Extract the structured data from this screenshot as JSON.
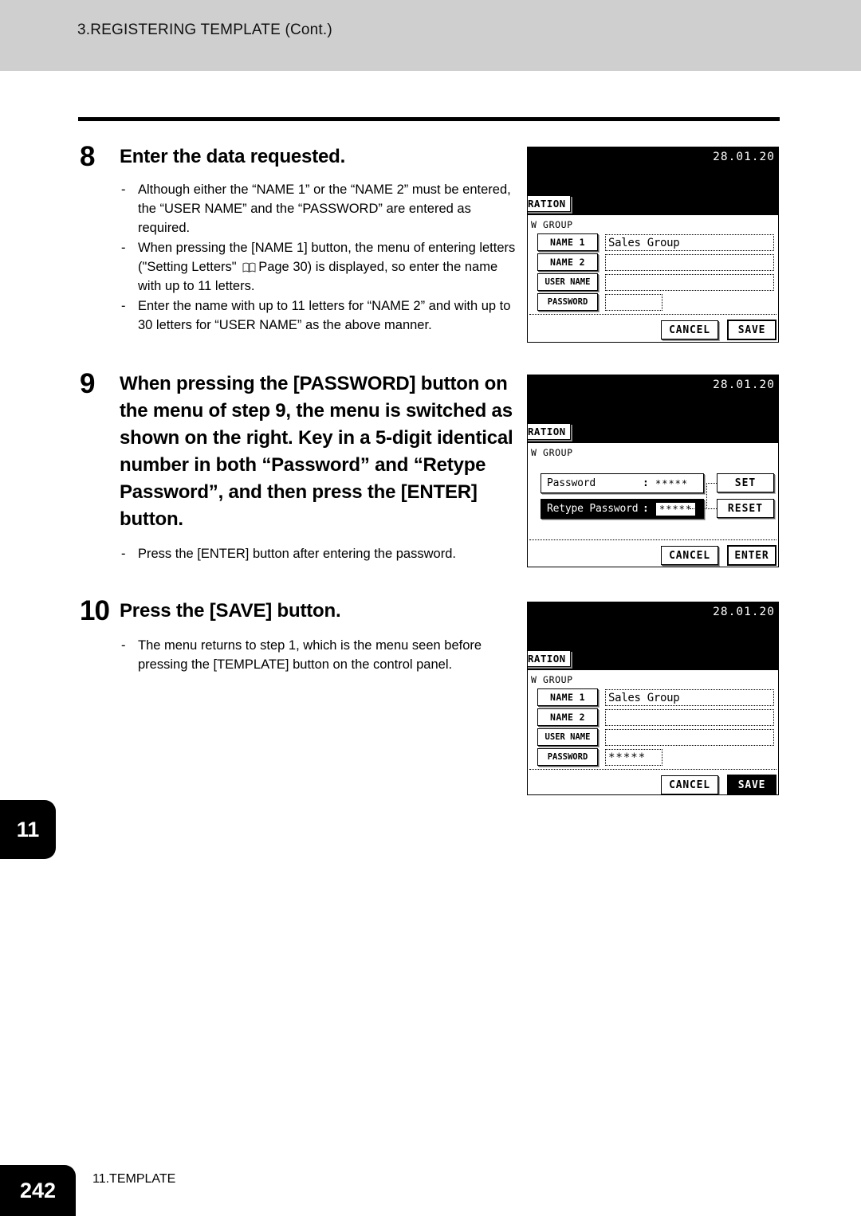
{
  "header": {
    "running_head": "3.REGISTERING TEMPLATE (Cont.)"
  },
  "steps": [
    {
      "number": "8",
      "title": "Enter the data requested.",
      "bullets": [
        "Although either the “NAME 1” or the “NAME 2” must be entered, the “USER NAME” and the “PASSWORD” are entered as required.",
        "When pressing the [NAME 1] button, the menu of entering letters (\"Setting Letters\" ",
        "Enter the name with up to 11 letters for “NAME 2” and with up to 30 letters for “USER NAME” as the above manner."
      ],
      "bullet2_tail": "Page 30) is displayed, so enter the name with up to 11 letters.",
      "dash": "-"
    },
    {
      "number": "9",
      "title": "When pressing the [PASSWORD] button on the menu of step 9, the menu is switched as shown on the right. Key in a 5-digit identical number in both “Password” and “Retype Password”, and then press the [ENTER] button.",
      "bullets": [
        "Press the [ENTER] button after entering the password."
      ],
      "dash": "-"
    },
    {
      "number": "10",
      "title": "Press the [SAVE] button.",
      "bullets": [
        "The menu returns to step 1, which is the menu seen before pressing the [TEMPLATE] button on the control panel."
      ],
      "dash": "-"
    }
  ],
  "lcd_form": {
    "date": "28.01.20",
    "tab_label": "RATION",
    "subtitle": "W GROUP",
    "fields": [
      {
        "button": "NAME 1",
        "value": "Sales Group"
      },
      {
        "button": "NAME 2",
        "value": ""
      },
      {
        "button": "USER NAME",
        "value": ""
      },
      {
        "button": "PASSWORD",
        "value": ""
      }
    ],
    "cancel": "CANCEL",
    "save": "SAVE"
  },
  "lcd_form_saved": {
    "date": "28.01.20",
    "tab_label": "RATION",
    "subtitle": "W GROUP",
    "fields": [
      {
        "button": "NAME 1",
        "value": "Sales Group"
      },
      {
        "button": "NAME 2",
        "value": ""
      },
      {
        "button": "USER NAME",
        "value": ""
      },
      {
        "button": "PASSWORD",
        "value": "*****"
      }
    ],
    "cancel": "CANCEL",
    "save": "SAVE"
  },
  "lcd_password": {
    "date": "28.01.20",
    "tab_label": "RATION",
    "subtitle": "W GROUP",
    "rows": [
      {
        "label": "Password",
        "colon": ":",
        "value": "*****"
      },
      {
        "label": "Retype Password",
        "colon": ":",
        "value": "*****"
      }
    ],
    "set": "SET",
    "reset": "RESET",
    "cancel": "CANCEL",
    "enter": "ENTER"
  },
  "chapter_tab": "11",
  "footer": {
    "page_number": "242",
    "section": "11.TEMPLATE"
  }
}
